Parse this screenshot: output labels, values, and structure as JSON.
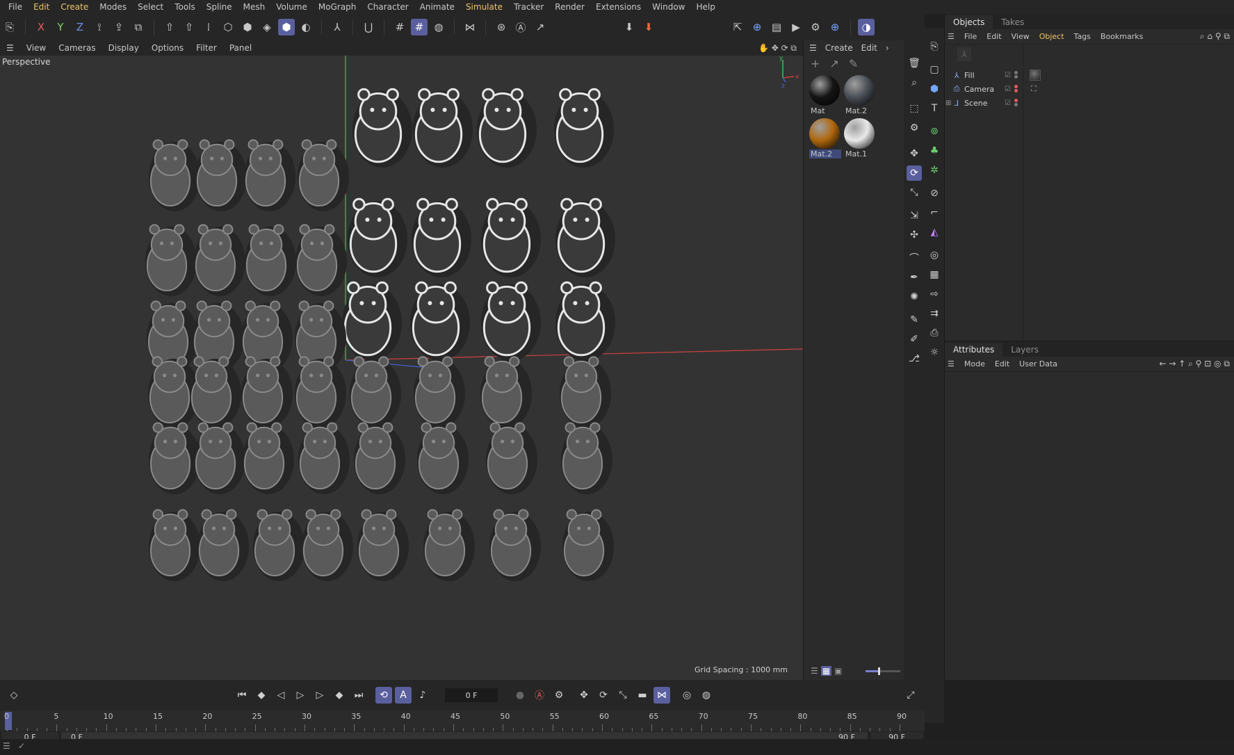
{
  "menubar": {
    "items": [
      "File",
      "Edit",
      "Create",
      "Modes",
      "Select",
      "Tools",
      "Spline",
      "Mesh",
      "Volume",
      "MoGraph",
      "Character",
      "Animate",
      "Simulate",
      "Tracker",
      "Render",
      "Extensions",
      "Window",
      "Help"
    ],
    "highlighted": [
      "Edit",
      "Create",
      "Simulate"
    ]
  },
  "toolbar": {
    "axis_x": "X",
    "axis_y": "Y",
    "axis_z": "Z"
  },
  "viewport_menu": {
    "items": [
      "View",
      "Cameras",
      "Display",
      "Options",
      "Filter",
      "Panel"
    ]
  },
  "viewport": {
    "camera_label": "Perspective",
    "grid_spacing": "Grid Spacing : 1000 mm",
    "axis_colors": {
      "x": "#d04040",
      "y": "#40c060",
      "z": "#4060d0"
    }
  },
  "materials": {
    "menu": [
      "Create",
      "Edit"
    ],
    "items": [
      {
        "name": "Mat",
        "color": "#151515",
        "selected": false
      },
      {
        "name": "Mat.2",
        "color": "#4a4f57",
        "selected": false
      },
      {
        "name": "Mat.2",
        "color": "#b0680e",
        "selected": true
      },
      {
        "name": "Mat.1",
        "color": "#e8e8e8",
        "selected": false
      }
    ]
  },
  "objects_panel": {
    "tabs": [
      "Objects",
      "Takes"
    ],
    "menu": [
      "File",
      "Edit",
      "View",
      "Object",
      "Tags",
      "Bookmarks"
    ],
    "active_menu": "Object",
    "objects": [
      "Fill",
      "Camera",
      "Scene"
    ]
  },
  "attributes_panel": {
    "tabs": [
      "Attributes",
      "Layers"
    ],
    "menu": [
      "Mode",
      "Edit",
      "User Data"
    ]
  },
  "timeline": {
    "current_frame": "0 F",
    "ruler_labels": [
      "0",
      "5",
      "10",
      "15",
      "20",
      "25",
      "30",
      "35",
      "40",
      "45",
      "50",
      "55",
      "60",
      "65",
      "70",
      "75",
      "80",
      "85",
      "90"
    ],
    "range_start": "0 F",
    "range_start_2": "0 F",
    "range_end": "90 F",
    "range_end_2": "90 F"
  },
  "accent_color": "#5a5f9e",
  "highlight_text_color": "#f0c36a"
}
